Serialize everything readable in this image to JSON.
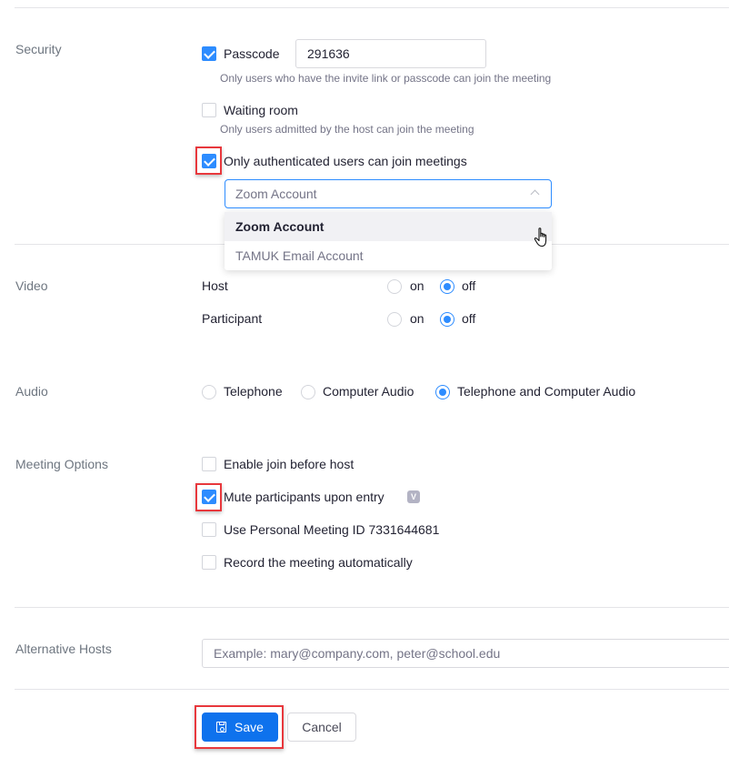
{
  "security": {
    "label": "Security",
    "passcode": {
      "label": "Passcode",
      "checked": true,
      "value": "291636",
      "hint": "Only users who have the invite link or passcode can join the meeting"
    },
    "waiting_room": {
      "label": "Waiting room",
      "checked": false,
      "hint": "Only users admitted by the host can join the meeting"
    },
    "authenticated": {
      "label": "Only authenticated users can join meetings",
      "checked": true,
      "select": {
        "value": "Zoom Account",
        "expanded": true,
        "options": [
          "Zoom Account",
          "TAMUK Email Account"
        ],
        "hovered_option": "Zoom Account"
      }
    }
  },
  "video": {
    "label": "Video",
    "host": {
      "label": "Host",
      "on_label": "on",
      "off_label": "off",
      "selected": "off"
    },
    "participant": {
      "label": "Participant",
      "on_label": "on",
      "off_label": "off",
      "selected": "off"
    }
  },
  "audio": {
    "label": "Audio",
    "options": [
      "Telephone",
      "Computer Audio",
      "Telephone and Computer Audio"
    ],
    "selected": "Telephone and Computer Audio"
  },
  "meeting_options": {
    "label": "Meeting Options",
    "items": [
      {
        "label": "Enable join before host",
        "checked": false
      },
      {
        "label": "Mute participants upon entry",
        "checked": true,
        "badge": "V"
      },
      {
        "label": "Use Personal Meeting ID 7331644681",
        "checked": false
      },
      {
        "label": "Record the meeting automatically",
        "checked": false
      }
    ]
  },
  "alternative_hosts": {
    "label": "Alternative Hosts",
    "value": "",
    "placeholder": "Example: mary@company.com, peter@school.edu"
  },
  "actions": {
    "save_label": "Save",
    "cancel_label": "Cancel"
  },
  "colors": {
    "accent": "#2d8cff",
    "primary_button": "#0e72ed",
    "highlight": "#e8383d"
  }
}
